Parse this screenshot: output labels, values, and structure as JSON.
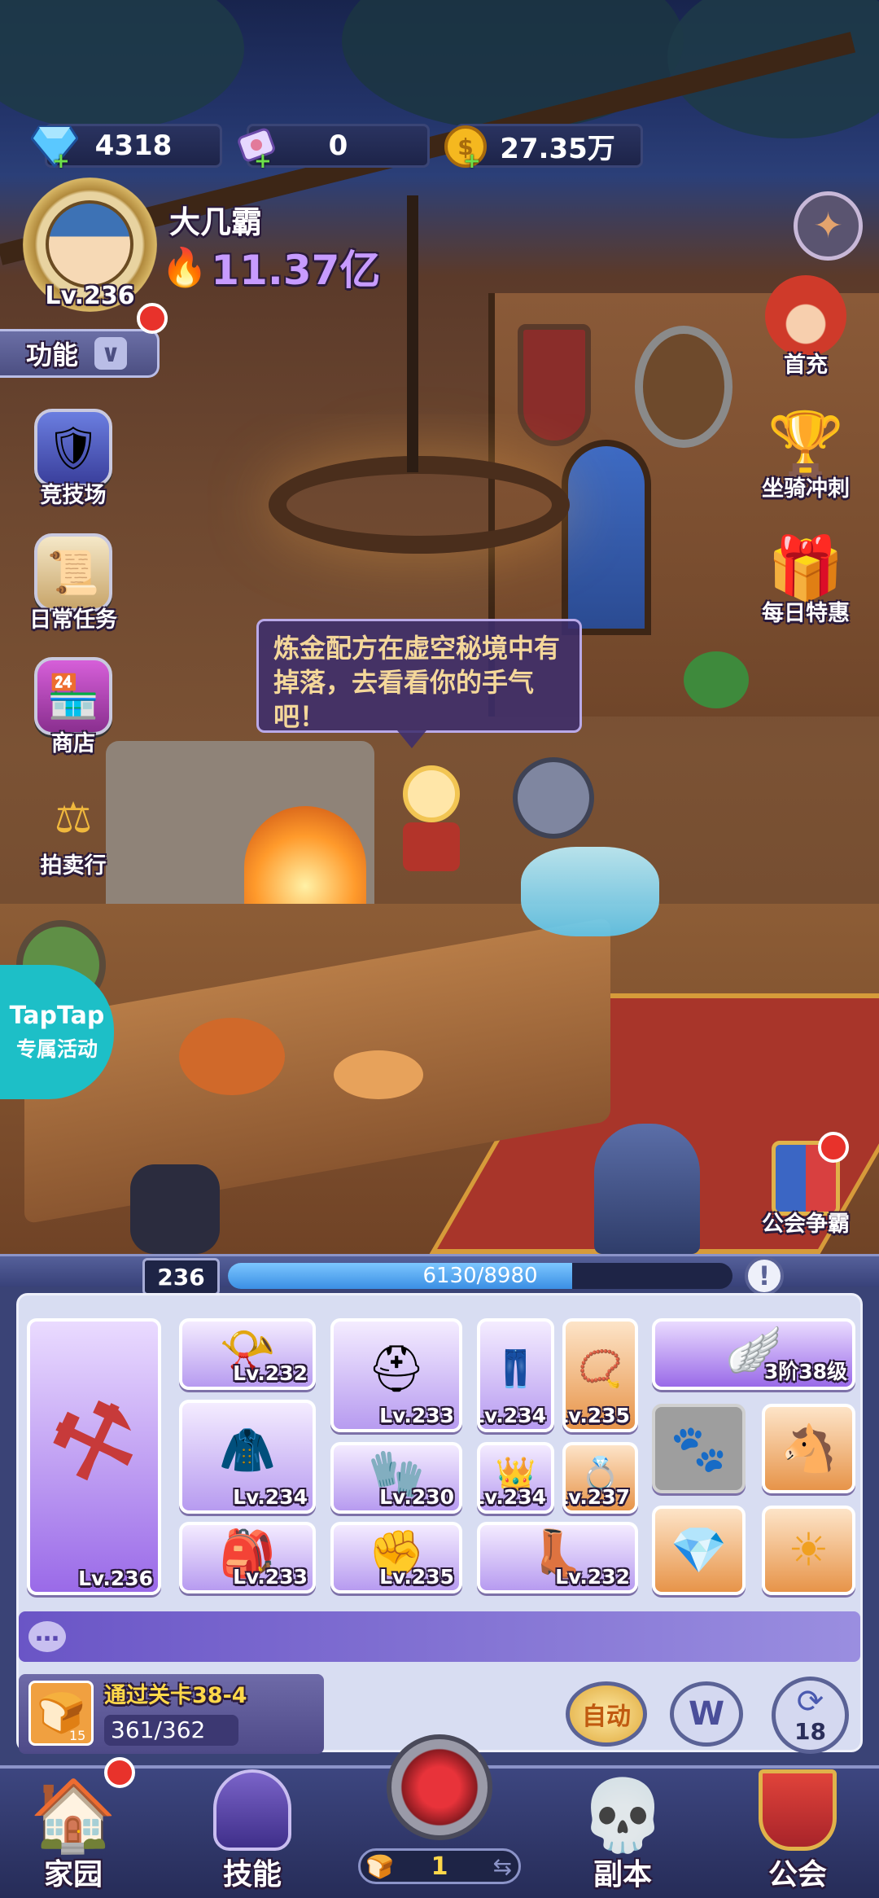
{
  "resources": {
    "diamonds": "4318",
    "scrolls": "0",
    "gold": "27.35万"
  },
  "player": {
    "name": "大几霸",
    "power": "11.37亿",
    "level": "Lv.236"
  },
  "menu_toggle": "功能",
  "left_buttons": [
    "竞技场",
    "日常任务",
    "商店",
    "拍卖行"
  ],
  "right_buttons": [
    "首充",
    "坐骑冲刺",
    "每日特惠",
    "公会争霸"
  ],
  "taptap": {
    "line1": "TapTap",
    "line2": "专属活动"
  },
  "speech": "炼金配方在虚空秘境中有掉落，去看看你的手气吧！",
  "xp": {
    "level": "236",
    "progress": "6130/8980",
    "fraction": 0.6826
  },
  "weapon_level": "Lv.236",
  "equipment_levels": [
    "Lv.232",
    "Lv.233",
    "Lv.234",
    "Lv.235",
    "Lv.234",
    "Lv.230",
    "Lv.234",
    "Lv.237",
    "Lv.233",
    "Lv.235",
    "Lv.232"
  ],
  "wings_level": "3阶38级",
  "quest": {
    "title": "通过关卡38-4",
    "progress": "361/362",
    "count": "15"
  },
  "auto_button": "自动",
  "w_button": "W",
  "timer_count": "18",
  "nav": {
    "home": "家园",
    "skills": "技能",
    "stage_count": "1",
    "dungeon": "副本",
    "guild": "公会"
  },
  "colors": {
    "accent": "#7b56d8",
    "red_dot": "#e8322b",
    "xp_fill": "#4fa8f0"
  }
}
